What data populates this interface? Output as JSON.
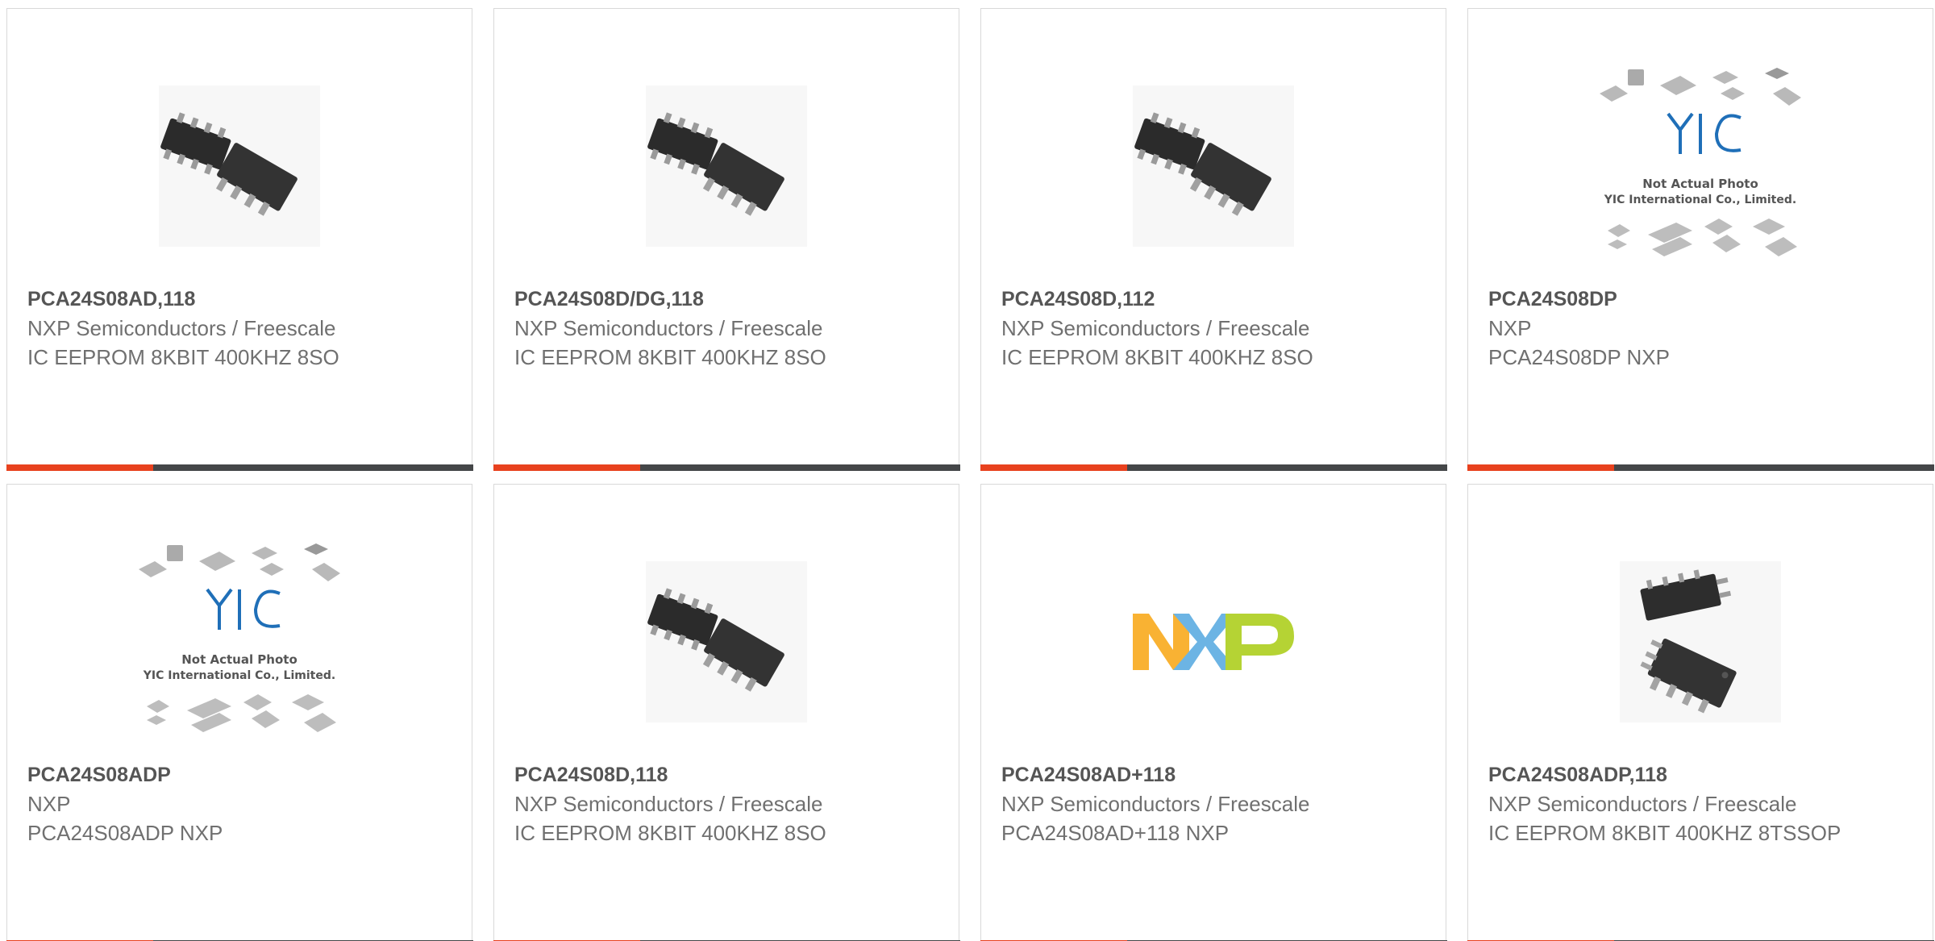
{
  "colors": {
    "accent": "#e8411e",
    "bar": "#444648",
    "title_text": "#555555",
    "body_text": "#707070",
    "border": "#d9d9d9"
  },
  "products": [
    {
      "part": "PCA24S08AD,118",
      "manufacturer": "NXP Semiconductors / Freescale",
      "description": "IC EEPROM 8KBIT 400KHZ 8SO",
      "image": "soic-8-chips"
    },
    {
      "part": "PCA24S08D/DG,118",
      "manufacturer": "NXP Semiconductors / Freescale",
      "description": "IC EEPROM 8KBIT 400KHZ 8SO",
      "image": "soic-8-chips"
    },
    {
      "part": "PCA24S08D,112",
      "manufacturer": "NXP Semiconductors / Freescale",
      "description": "IC EEPROM 8KBIT 400KHZ 8SO",
      "image": "soic-8-chips"
    },
    {
      "part": "PCA24S08DP",
      "manufacturer": "NXP",
      "description": "PCA24S08DP NXP",
      "image": "yic-placeholder",
      "placeholder_line1": "Not Actual Photo",
      "placeholder_line2": "YIC International Co., Limited."
    },
    {
      "part": "PCA24S08ADP",
      "manufacturer": "NXP",
      "description": "PCA24S08ADP NXP",
      "image": "yic-placeholder",
      "placeholder_line1": "Not Actual Photo",
      "placeholder_line2": "YIC International Co., Limited."
    },
    {
      "part": "PCA24S08D,118",
      "manufacturer": "NXP Semiconductors / Freescale",
      "description": "IC EEPROM 8KBIT 400KHZ 8SO",
      "image": "soic-8-chips"
    },
    {
      "part": "PCA24S08AD+118",
      "manufacturer": "NXP Semiconductors / Freescale",
      "description": "PCA24S08AD+118 NXP",
      "image": "nxp-logo"
    },
    {
      "part": "PCA24S08ADP,118",
      "manufacturer": "NXP Semiconductors / Freescale",
      "description": "IC EEPROM 8KBIT 400KHZ 8TSSOP",
      "image": "tssop-8-chips"
    }
  ]
}
